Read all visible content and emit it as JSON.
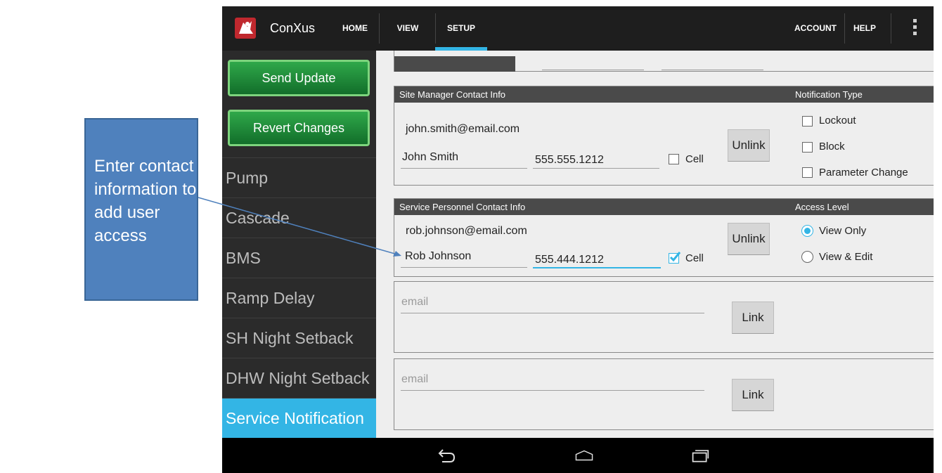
{
  "callout": {
    "text": "Enter contact information to add user access",
    "color": "#4f81bd"
  },
  "actionbar": {
    "app_title": "ConXus",
    "tabs": [
      {
        "label": "HOME"
      },
      {
        "label": "VIEW"
      },
      {
        "label": "SETUP",
        "selected": true
      },
      {
        "label": "ACCOUNT"
      },
      {
        "label": "HELP"
      }
    ],
    "accent": "#33b5e5"
  },
  "sidebar": {
    "send_update": "Send Update",
    "revert_changes": "Revert Changes",
    "items": [
      {
        "label": "Pump"
      },
      {
        "label": "Cascade"
      },
      {
        "label": "BMS"
      },
      {
        "label": "Ramp Delay"
      },
      {
        "label": "SH Night Setback"
      },
      {
        "label": "DHW Night Setback"
      },
      {
        "label": "Service Notification",
        "active": true
      }
    ]
  },
  "site_manager": {
    "header": "Site Manager Contact Info",
    "type_header": "Notification Type",
    "email": "john.smith@email.com",
    "name": "John Smith",
    "phone": "555.555.1212",
    "cell_label": "Cell",
    "cell_checked": false,
    "unlink_label": "Unlink",
    "notification_types": [
      {
        "label": "Lockout",
        "checked": false
      },
      {
        "label": "Block",
        "checked": false
      },
      {
        "label": "Parameter Change",
        "checked": false
      }
    ]
  },
  "service_personnel": {
    "header": "Service Personnel Contact Info",
    "access_header": "Access Level",
    "email": "rob.johnson@email.com",
    "name": "Rob Johnson",
    "phone": "555.444.1212",
    "cell_label": "Cell",
    "cell_checked": true,
    "unlink_label": "Unlink",
    "access_levels": [
      {
        "label": "View Only",
        "selected": true
      },
      {
        "label": "View & Edit",
        "selected": false
      }
    ]
  },
  "link_rows": [
    {
      "placeholder": "email",
      "button": "Link"
    },
    {
      "placeholder": "email",
      "button": "Link"
    }
  ],
  "navbar": {
    "icons": [
      "back-icon",
      "home-icon",
      "recent-apps-icon"
    ]
  }
}
